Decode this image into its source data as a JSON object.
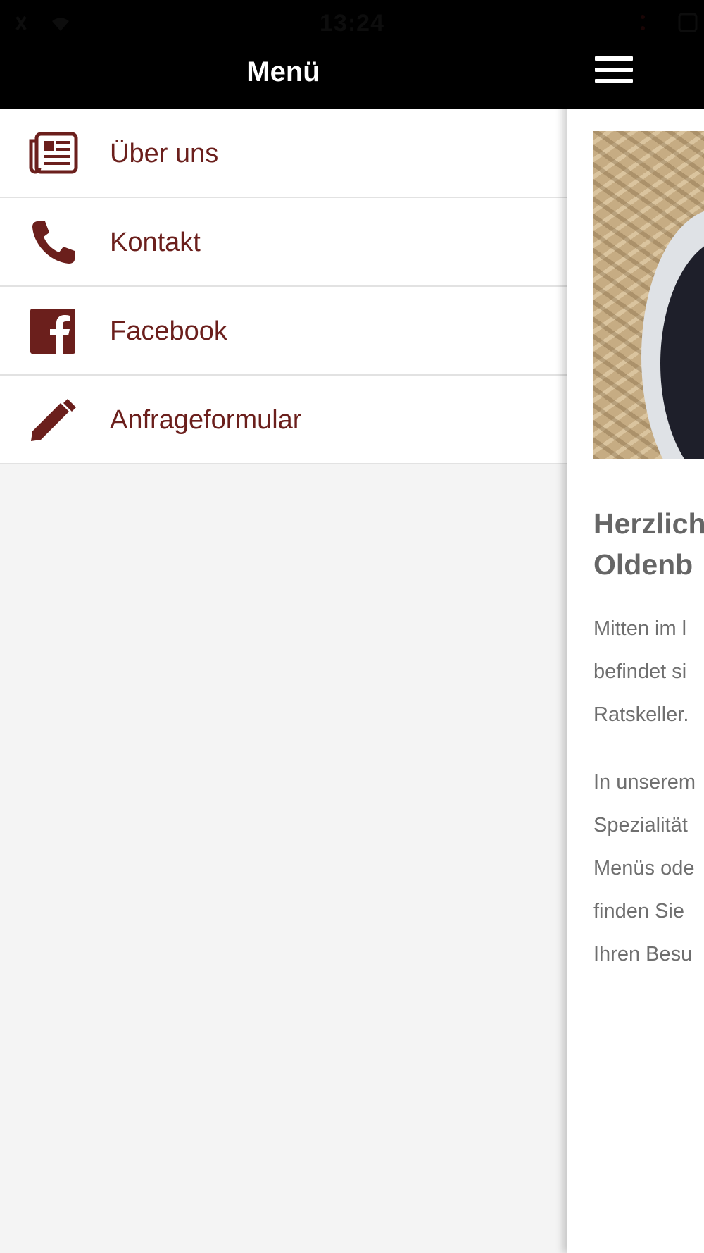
{
  "status_bar": {
    "time": "13:24"
  },
  "drawer": {
    "title": "Menü",
    "items": [
      {
        "label": "Über uns",
        "icon": "newspaper-icon"
      },
      {
        "label": "Kontakt",
        "icon": "phone-icon"
      },
      {
        "label": "Facebook",
        "icon": "facebook-icon"
      },
      {
        "label": "Anfrageformular",
        "icon": "pencil-icon"
      }
    ]
  },
  "content": {
    "heading_lines": [
      "Herzlich",
      "Oldenb"
    ],
    "paragraph1_lines": [
      "Mitten im l",
      "befindet si",
      "Ratskeller."
    ],
    "paragraph2_lines": [
      "In unserem",
      "Spezialität",
      "Menüs ode",
      "finden Sie",
      "Ihren Besu"
    ]
  },
  "colors": {
    "header_bg": "#000000",
    "accent": "#6b1f1c",
    "drawer_bg": "#f4f4f4",
    "content_text": "#6f6f6f"
  }
}
